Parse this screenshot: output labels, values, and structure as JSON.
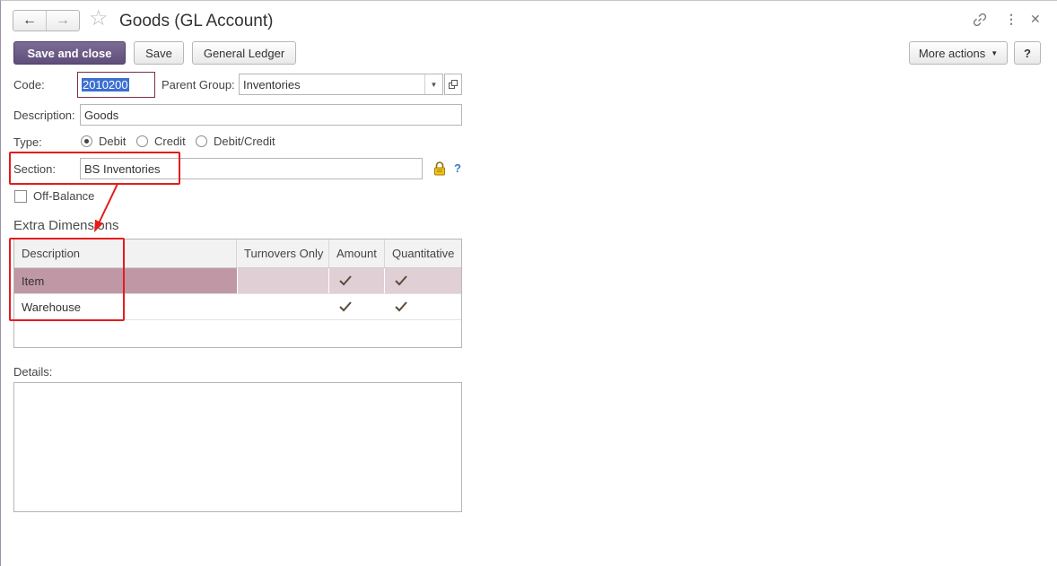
{
  "header": {
    "title": "Goods (GL Account)",
    "back_icon": "arrow-left-icon",
    "forward_icon": "arrow-right-icon",
    "favorite_icon": "star-icon",
    "link_icon": "link-icon",
    "menu_icon": "more-vertical-icon",
    "close_icon": "close-icon"
  },
  "toolbar": {
    "save_and_close": "Save and close",
    "save": "Save",
    "general_ledger": "General Ledger",
    "more_actions": "More actions",
    "help": "?"
  },
  "form": {
    "code_label": "Code:",
    "code_value": "2010200",
    "parent_group_label": "Parent Group:",
    "parent_group_value": "Inventories",
    "description_label": "Description:",
    "description_value": "Goods",
    "type_label": "Type:",
    "type_options": [
      {
        "label": "Debit",
        "selected": true
      },
      {
        "label": "Credit",
        "selected": false
      },
      {
        "label": "Debit/Credit",
        "selected": false
      }
    ],
    "section_label": "Section:",
    "section_value": "BS Inventories",
    "section_help": "?",
    "off_balance_label": "Off-Balance",
    "off_balance_checked": false
  },
  "extra_dimensions": {
    "title": "Extra Dimensions",
    "columns": [
      "Description",
      "Turnovers Only",
      "Amount",
      "Quantitative"
    ],
    "rows": [
      {
        "description": "Item",
        "turnovers_only": false,
        "amount": true,
        "quantitative": true,
        "selected": true
      },
      {
        "description": "Warehouse",
        "turnovers_only": false,
        "amount": true,
        "quantitative": true,
        "selected": false
      }
    ]
  },
  "details": {
    "label": "Details:",
    "value": ""
  },
  "colors": {
    "primary_button": "#5f4e7a",
    "selected_row": "#c097a5",
    "selected_row_light": "#e1cfd6",
    "annotation_red": "#e41c1c",
    "checkmark": "#5a4a3a"
  }
}
